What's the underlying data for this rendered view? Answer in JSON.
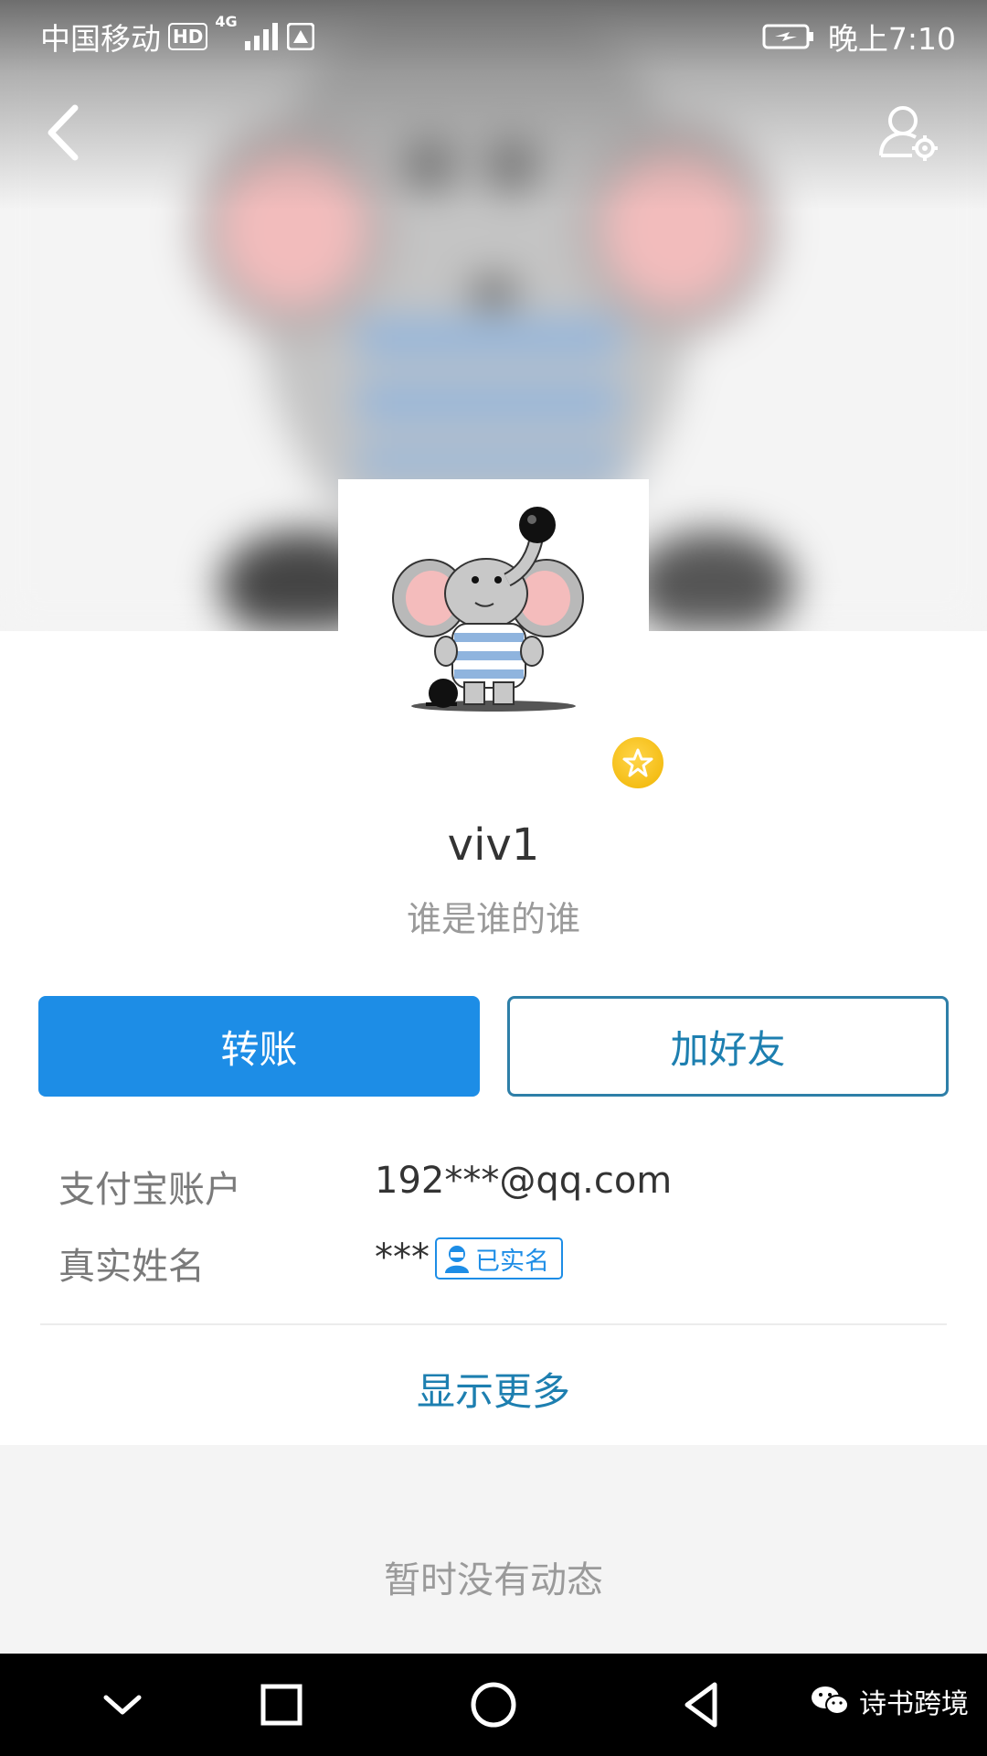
{
  "status_bar": {
    "carrier": "中国移动",
    "hd_label": "HD",
    "network": "4G",
    "time": "晚上7:10"
  },
  "nav": {
    "back_icon": "chevron-left-icon",
    "settings_icon": "person-gear-icon"
  },
  "profile": {
    "nickname": "viv1",
    "signature": "谁是谁的谁",
    "badge_icon": "star-badge-icon",
    "avatar_description_icon": "cartoon-elephant-avatar"
  },
  "actions": {
    "transfer_label": "转账",
    "add_friend_label": "加好友"
  },
  "info": {
    "account_label": "支付宝账户",
    "account_value": "192***@qq.com",
    "realname_label": "真实姓名",
    "realname_value": "***",
    "verified_label": "已实名"
  },
  "show_more_label": "显示更多",
  "feed": {
    "empty_text": "暂时没有动态"
  },
  "system_nav": {
    "watermark": "诗书跨境"
  },
  "colors": {
    "primary": "#1d8de6",
    "link": "#1d7fb0",
    "badge": "#f0b400"
  }
}
